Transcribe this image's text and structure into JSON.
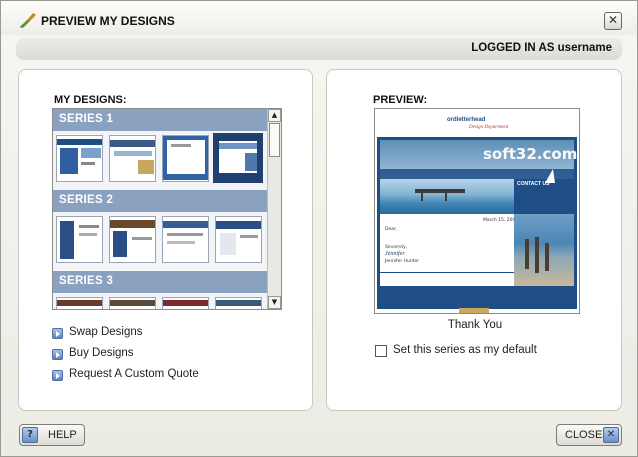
{
  "window": {
    "title": "PREVIEW MY DESIGNS",
    "close_glyph": "✕"
  },
  "userbar": {
    "text": "LOGGED IN AS username"
  },
  "designs": {
    "heading": "MY DESIGNS:",
    "series": [
      {
        "name": "SERIES 1"
      },
      {
        "name": "SERIES 2"
      },
      {
        "name": "SERIES 3"
      }
    ]
  },
  "links": [
    {
      "label": "Swap Designs",
      "icon": "arrow-bullet-icon"
    },
    {
      "label": "Buy Designs",
      "icon": "arrow-bullet-icon"
    },
    {
      "label": "Request A Custom Quote",
      "icon": "arrow-bullet-icon"
    }
  ],
  "preview": {
    "heading": "PREVIEW:",
    "brand": "ordletterhead",
    "brand_sub": "Design Department",
    "watermark": "soft32.com",
    "contact_label": "CONTACT US",
    "date": "March 15, 2006",
    "greeting": "Dear,",
    "closing": "Sincerely,",
    "signature": "Jennifer",
    "signer": "Jennifer Hunter",
    "caption": "Thank You"
  },
  "default_option": {
    "label": "Set this series as my default",
    "checked": false
  },
  "footer": {
    "help_icon": "?",
    "help_label": "HELP",
    "close_label": "CLOSE",
    "close_icon": "✕"
  },
  "colors": {
    "series_header": "#8aa2bf",
    "preview_navy": "#1f4e86",
    "link_bullet": "#5d83bd"
  }
}
